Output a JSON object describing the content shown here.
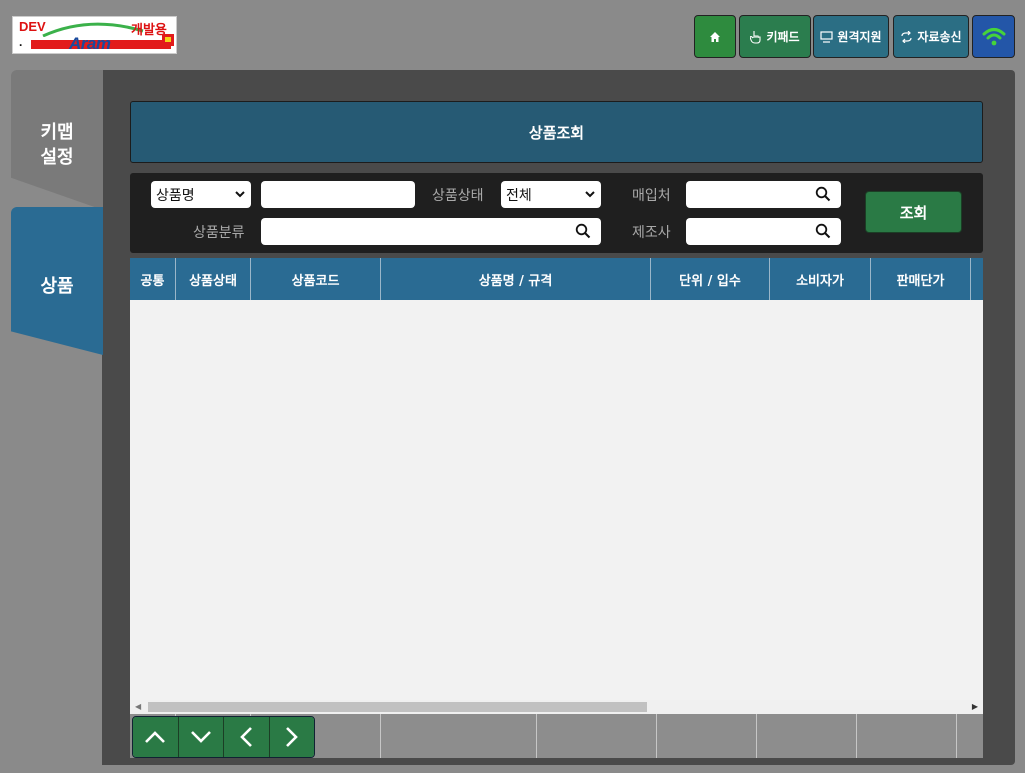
{
  "logo": {
    "env_label": "DEV",
    "dev_label": "개발용",
    "brand_text": "Aram",
    "dot": "."
  },
  "topbar": {
    "home_icon": "home-icon",
    "keypad_label": "키패드",
    "remote_label": "원격지원",
    "send_label": "자료송신",
    "wifi_icon": "wifi-icon"
  },
  "sidebar": {
    "tabs": [
      {
        "label_line1": "키맵",
        "label_line2": "설정",
        "active": false
      },
      {
        "label_line1": "상품",
        "active": true
      }
    ]
  },
  "page": {
    "title": "상품조회"
  },
  "search": {
    "field_select": "상품명",
    "field_input_value": "",
    "status_label": "상품상태",
    "status_select": "전체",
    "vendor_label": "매입처",
    "vendor_value": "",
    "category_label": "상품분류",
    "category_value": "",
    "maker_label": "제조사",
    "maker_value": "",
    "search_button": "조회"
  },
  "grid": {
    "columns": [
      "공통",
      "상품상태",
      "상품코드",
      "상품명 / 규격",
      "단위 / 입수",
      "소비자가",
      "판매단가"
    ],
    "rows": []
  },
  "nav": [
    "up-arrow-icon",
    "down-arrow-icon",
    "left-arrow-icon",
    "right-arrow-icon"
  ],
  "colors": {
    "accent_blue": "#2a6b93",
    "accent_green": "#2a7a45",
    "panel_dark": "#4a4a4a",
    "background": "#8a8a8a"
  }
}
